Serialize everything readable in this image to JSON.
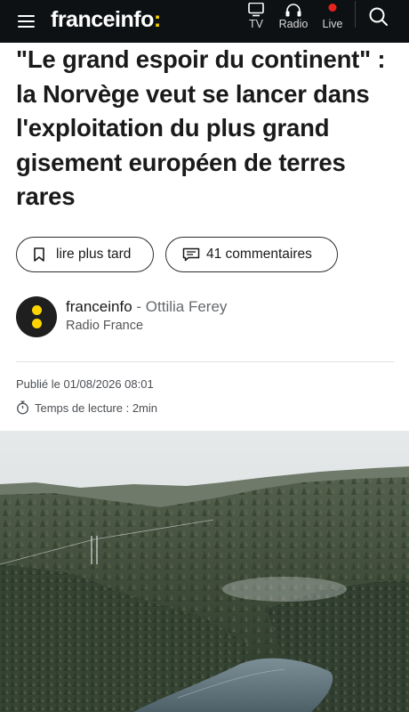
{
  "header": {
    "logo_main": "franceinfo",
    "logo_colon": ":",
    "nav": {
      "tv_label": "TV",
      "radio_label": "Radio",
      "live_label": "Live"
    },
    "colors": {
      "background": "#0e1113",
      "accent": "#ffd400",
      "live": "#e8231c"
    }
  },
  "article": {
    "headline": "\"Le grand espoir du continent\" : la Norvège veut se lancer dans l'exploitation du plus grand gisement européen de terres rares",
    "actions": {
      "save_label": "lire plus tard",
      "comments_label": "41 commentaires"
    },
    "author": {
      "source": "franceinfo",
      "separator": " - ",
      "name": "Ottilia Ferey",
      "organization": "Radio France"
    },
    "published": "Publié le 01/08/2026 08:01",
    "reading_time": "Temps de lecture : 2min"
  },
  "icons": {
    "menu": "hamburger-icon",
    "tv": "tv-icon",
    "radio": "headphones-icon",
    "live": "live-dot-icon",
    "search": "search-icon",
    "bookmark": "bookmark-icon",
    "comments": "comment-icon",
    "timer": "stopwatch-icon"
  }
}
